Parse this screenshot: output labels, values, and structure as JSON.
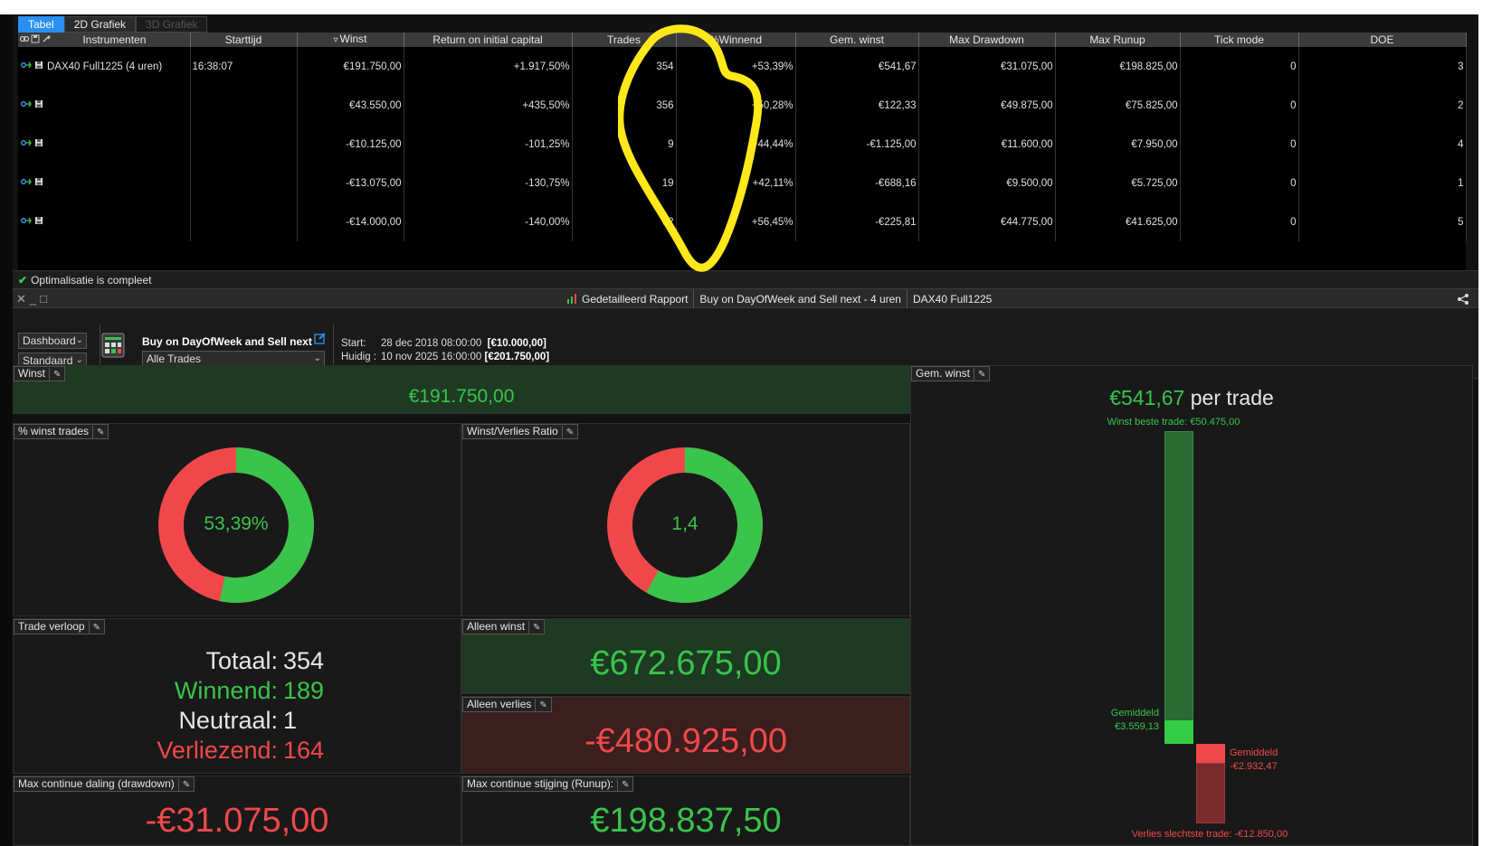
{
  "tabs": [
    {
      "label": "Tabel",
      "active": true
    },
    {
      "label": "2D Grafiek",
      "active": false
    },
    {
      "label": "3D Grafiek",
      "active": false,
      "disabled": true
    }
  ],
  "table": {
    "columns": [
      "Instrumenten",
      "Starttijd",
      "Winst",
      "Return on initial capital",
      "Trades",
      "%Winnend",
      "Gem. winst",
      "Max Drawdown",
      "Max Runup",
      "Tick mode",
      "DOE"
    ],
    "sort_indicator": "▿",
    "rows": [
      {
        "instrument": "DAX40 Full1225 (4 uren)",
        "start": "16:38:07",
        "winst": "€191.750,00",
        "return": "+1.917,50%",
        "trades": "354",
        "winnend": "+53,39%",
        "gem": "€541,67",
        "drawdown": "€31.075,00",
        "runup": "€198.825,00",
        "tick": "0",
        "doe": "3"
      },
      {
        "instrument": "",
        "start": "",
        "winst": "€43.550,00",
        "return": "+435,50%",
        "trades": "356",
        "winnend": "+50,28%",
        "gem": "€122,33",
        "drawdown": "€49.875,00",
        "runup": "€75.825,00",
        "tick": "0",
        "doe": "2"
      },
      {
        "instrument": "",
        "start": "",
        "winst": "-€10.125,00",
        "return": "-101,25%",
        "trades": "9",
        "winnend": "+44,44%",
        "gem": "-€1.125,00",
        "drawdown": "€11.600,00",
        "runup": "€7.950,00",
        "tick": "0",
        "doe": "4"
      },
      {
        "instrument": "",
        "start": "",
        "winst": "-€13.075,00",
        "return": "-130,75%",
        "trades": "19",
        "winnend": "+42,11%",
        "gem": "-€688,16",
        "drawdown": "€9.500,00",
        "runup": "€5.725,00",
        "tick": "0",
        "doe": "1"
      },
      {
        "instrument": "",
        "start": "",
        "winst": "-€14.000,00",
        "return": "-140,00%",
        "trades": "62",
        "winnend": "+56,45%",
        "gem": "-€225,81",
        "drawdown": "€44.775,00",
        "runup": "€41.625,00",
        "tick": "0",
        "doe": "5"
      }
    ]
  },
  "status": {
    "text": "Optimalisatie is compleet"
  },
  "report_bar": {
    "items": [
      "Gedetailleerd Rapport",
      "Buy on DayOfWeek and Sell next - 4 uren",
      "DAX40 Full1225"
    ]
  },
  "controls": {
    "view_select": "Dashboard",
    "layout_select": "Standaard",
    "strategy_name": "Buy on DayOfWeek and Sell next",
    "trades_select": "Alle Trades",
    "start_label": "Start:",
    "start_date": "28 dec 2018 08:00:00",
    "start_capital": "[€10.000,00]",
    "current_label": "Huidig :",
    "current_date": "10 nov 2025 16:00:00",
    "current_capital": "[€201.750,00]"
  },
  "panels": {
    "winst": {
      "title": "Winst",
      "value": "€191.750,00"
    },
    "pct_winst": {
      "title": "% winst trades",
      "value": "53,39%",
      "fraction": 0.5339
    },
    "ratio": {
      "title": "Winst/Verlies Ratio",
      "value": "1,4",
      "fraction": 0.583
    },
    "verloop": {
      "title": "Trade verloop",
      "totaal_label": "Totaal:",
      "totaal": "354",
      "winnend_label": "Winnend:",
      "winnend": "189",
      "neutraal_label": "Neutraal:",
      "neutraal": "1",
      "verliezend_label": "Verliezend:",
      "verliezend": "164"
    },
    "alleen_winst": {
      "title": "Alleen winst",
      "value": "€672.675,00"
    },
    "alleen_verlies": {
      "title": "Alleen verlies",
      "value": "-€480.925,00"
    },
    "drawdown": {
      "title": "Max continue daling (drawdown)",
      "value": "-€31.075,00"
    },
    "runup": {
      "title": "Max continue stijging (Runup):",
      "value": "€198.837,50"
    },
    "gem_winst": {
      "title": "Gem. winst",
      "value": "€541,67",
      "suffix": "per trade",
      "best_label": "Winst beste trade: €50.475,00",
      "avg_win_label": "Gemiddeld",
      "avg_win_value": "€3.559,13",
      "avg_loss_label": "Gemiddeld",
      "avg_loss_value": "-€2.932,47",
      "worst_label": "Verlies slechtste trade: -€12.850,00"
    }
  },
  "colors": {
    "green": "#39c44b",
    "red": "#f0484a",
    "accent_blue": "#2a8ff0",
    "annotation_yellow": "#ffe81a"
  }
}
